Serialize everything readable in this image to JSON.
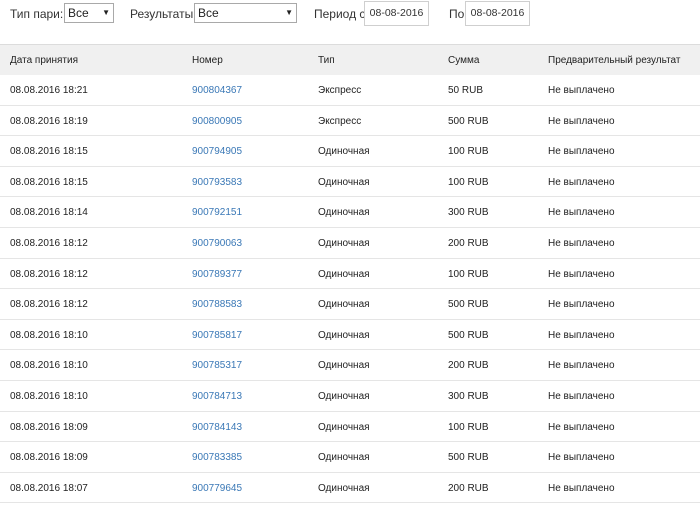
{
  "filters": {
    "bet_type_label": "Тип пари:",
    "bet_type_value": "Все",
    "results_label": "Результаты",
    "results_value": "Все",
    "period_from_label": "Период с",
    "period_from_value": "08-08-2016",
    "period_to_label": "По",
    "period_to_value": "08-08-2016"
  },
  "table": {
    "headers": [
      "Дата принятия",
      "Номер",
      "Тип",
      "Сумма",
      "Предварительный результат"
    ],
    "rows": [
      {
        "date": "08.08.2016 18:21",
        "number": "900804367",
        "type": "Экспресс",
        "amount": "50 RUB",
        "result": "Не выплачено"
      },
      {
        "date": "08.08.2016 18:19",
        "number": "900800905",
        "type": "Экспресс",
        "amount": "500 RUB",
        "result": "Не выплачено"
      },
      {
        "date": "08.08.2016 18:15",
        "number": "900794905",
        "type": "Одиночная",
        "amount": "100 RUB",
        "result": "Не выплачено"
      },
      {
        "date": "08.08.2016 18:15",
        "number": "900793583",
        "type": "Одиночная",
        "amount": "100 RUB",
        "result": "Не выплачено"
      },
      {
        "date": "08.08.2016 18:14",
        "number": "900792151",
        "type": "Одиночная",
        "amount": "300 RUB",
        "result": "Не выплачено"
      },
      {
        "date": "08.08.2016 18:12",
        "number": "900790063",
        "type": "Одиночная",
        "amount": "200 RUB",
        "result": "Не выплачено"
      },
      {
        "date": "08.08.2016 18:12",
        "number": "900789377",
        "type": "Одиночная",
        "amount": "100 RUB",
        "result": "Не выплачено"
      },
      {
        "date": "08.08.2016 18:12",
        "number": "900788583",
        "type": "Одиночная",
        "amount": "500 RUB",
        "result": "Не выплачено"
      },
      {
        "date": "08.08.2016 18:10",
        "number": "900785817",
        "type": "Одиночная",
        "amount": "500 RUB",
        "result": "Не выплачено"
      },
      {
        "date": "08.08.2016 18:10",
        "number": "900785317",
        "type": "Одиночная",
        "amount": "200 RUB",
        "result": "Не выплачено"
      },
      {
        "date": "08.08.2016 18:10",
        "number": "900784713",
        "type": "Одиночная",
        "amount": "300 RUB",
        "result": "Не выплачено"
      },
      {
        "date": "08.08.2016 18:09",
        "number": "900784143",
        "type": "Одиночная",
        "amount": "100 RUB",
        "result": "Не выплачено"
      },
      {
        "date": "08.08.2016 18:09",
        "number": "900783385",
        "type": "Одиночная",
        "amount": "500 RUB",
        "result": "Не выплачено"
      },
      {
        "date": "08.08.2016 18:07",
        "number": "900779645",
        "type": "Одиночная",
        "amount": "200 RUB",
        "result": "Не выплачено"
      }
    ]
  },
  "colors": {
    "link": "#3a78b6",
    "header_bg": "#f0f0f0"
  }
}
